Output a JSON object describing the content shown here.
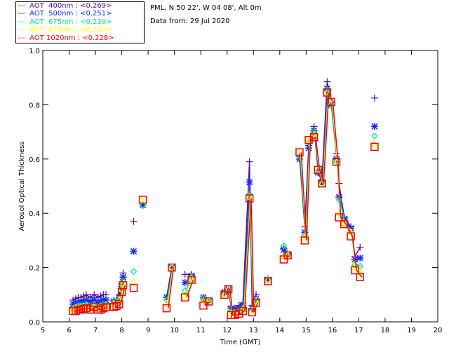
{
  "header": {
    "location": "PML, N 50 22', W 04 08', Alt 0m",
    "date": "Data from: 29 Jul 2020"
  },
  "chart_data": {
    "type": "scatter",
    "xlabel": "Time (GMT)",
    "ylabel": "Aerosol Optical Thickness",
    "xlim": [
      5,
      20
    ],
    "ylim": [
      0,
      1.0
    ],
    "xticks": [
      "5",
      "6",
      "7",
      "8",
      "9",
      "10",
      "11",
      "12",
      "13",
      "14",
      "15",
      "16",
      "17",
      "18",
      "19",
      "20"
    ],
    "yticks": [
      "0.0",
      "0.2",
      "0.4",
      "0.6",
      "0.8",
      "1.0"
    ],
    "legend_position": "top-left outside",
    "x": [
      6.15,
      6.25,
      6.35,
      6.45,
      6.55,
      6.65,
      6.8,
      6.95,
      7.1,
      7.2,
      7.3,
      7.4,
      7.7,
      7.8,
      7.9,
      8.0,
      8.05,
      8.45,
      8.8,
      9.7,
      9.9,
      10.4,
      10.65,
      11.1,
      11.3,
      11.9,
      12.05,
      12.15,
      12.3,
      12.45,
      12.6,
      12.85,
      12.95,
      13.1,
      13.55,
      14.15,
      14.3,
      14.75,
      14.95,
      15.1,
      15.3,
      15.45,
      15.6,
      15.8,
      15.95,
      16.15,
      16.25,
      16.45,
      16.7,
      16.85,
      17.05,
      17.6
    ],
    "series": [
      {
        "name": "AOT  400nm",
        "legend": "---  AOT  400nm : <0.269>",
        "color": "#5a0aa0",
        "marker": "plus",
        "values": [
          0.08,
          0.085,
          0.09,
          0.09,
          0.095,
          0.1,
          0.09,
          0.1,
          0.09,
          0.095,
          0.1,
          0.1,
          0.08,
          0.08,
          0.1,
          0.14,
          0.18,
          0.37,
          0.43,
          0.09,
          0.2,
          0.175,
          0.175,
          0.09,
          0.075,
          0.11,
          0.12,
          0.055,
          0.05,
          0.06,
          0.07,
          0.59,
          0.06,
          0.1,
          0.16,
          0.27,
          0.25,
          0.61,
          0.35,
          0.65,
          0.72,
          0.56,
          0.52,
          0.885,
          0.81,
          0.62,
          0.51,
          0.385,
          0.35,
          0.24,
          0.275,
          0.825
        ]
      },
      {
        "name": "AOT  500nm",
        "legend": "---  AOT  500nm : <0.251>",
        "color": "#1a2cff",
        "marker": "star",
        "values": [
          0.065,
          0.07,
          0.07,
          0.075,
          0.075,
          0.08,
          0.075,
          0.08,
          0.07,
          0.075,
          0.08,
          0.08,
          0.075,
          0.075,
          0.09,
          0.13,
          0.165,
          0.26,
          0.43,
          0.09,
          0.2,
          0.145,
          0.17,
          0.09,
          0.075,
          0.11,
          0.12,
          0.05,
          0.04,
          0.05,
          0.06,
          0.515,
          0.05,
          0.085,
          0.155,
          0.265,
          0.245,
          0.6,
          0.33,
          0.64,
          0.705,
          0.55,
          0.51,
          0.86,
          0.8,
          0.6,
          0.46,
          0.38,
          0.345,
          0.23,
          0.235,
          0.72
        ]
      },
      {
        "name": "AOT  675nm",
        "legend": "---  AOT  675nm : <0.239>",
        "color": "#00e87a",
        "marker": "diamond",
        "values": [
          0.05,
          0.055,
          0.06,
          0.06,
          0.06,
          0.065,
          0.06,
          0.065,
          0.055,
          0.06,
          0.065,
          0.065,
          0.07,
          0.07,
          0.085,
          0.12,
          0.15,
          0.185,
          0.43,
          0.08,
          0.2,
          0.115,
          0.165,
          0.085,
          0.075,
          0.105,
          0.12,
          0.04,
          0.035,
          0.04,
          0.05,
          0.47,
          0.045,
          0.08,
          0.155,
          0.28,
          0.245,
          0.61,
          0.32,
          0.66,
          0.7,
          0.56,
          0.51,
          0.855,
          0.8,
          0.59,
          0.45,
          0.36,
          0.33,
          0.21,
          0.205,
          0.685
        ]
      },
      {
        "name": "AOT  870nm",
        "legend": "---  AOT  870nm : <0.232>",
        "color": "#ffff00",
        "marker": "triangle",
        "values": [
          0.045,
          0.05,
          0.05,
          0.052,
          0.055,
          0.055,
          0.05,
          0.055,
          0.045,
          0.05,
          0.055,
          0.058,
          0.065,
          0.065,
          0.08,
          0.12,
          0.14,
          0.145,
          0.445,
          0.065,
          0.2,
          0.09,
          0.16,
          0.075,
          0.075,
          0.1,
          0.12,
          0.03,
          0.03,
          0.035,
          0.045,
          0.46,
          0.04,
          0.075,
          0.155,
          0.24,
          0.245,
          0.62,
          0.31,
          0.67,
          0.69,
          0.56,
          0.51,
          0.845,
          0.805,
          0.585,
          0.4,
          0.36,
          0.33,
          0.2,
          0.18,
          0.655
        ]
      },
      {
        "name": "AOT 1020nm",
        "legend": "---  AOT 1020nm : <0.228>",
        "color": "#ff0000",
        "marker": "square",
        "values": [
          0.04,
          0.04,
          0.045,
          0.045,
          0.048,
          0.05,
          0.045,
          0.055,
          0.045,
          0.045,
          0.05,
          0.055,
          0.055,
          0.058,
          0.065,
          0.11,
          0.135,
          0.125,
          0.45,
          0.05,
          0.2,
          0.09,
          0.155,
          0.06,
          0.075,
          0.1,
          0.12,
          0.025,
          0.025,
          0.03,
          0.04,
          0.455,
          0.035,
          0.07,
          0.15,
          0.23,
          0.245,
          0.625,
          0.3,
          0.67,
          0.68,
          0.56,
          0.51,
          0.845,
          0.81,
          0.59,
          0.385,
          0.36,
          0.315,
          0.19,
          0.165,
          0.645
        ]
      }
    ]
  }
}
